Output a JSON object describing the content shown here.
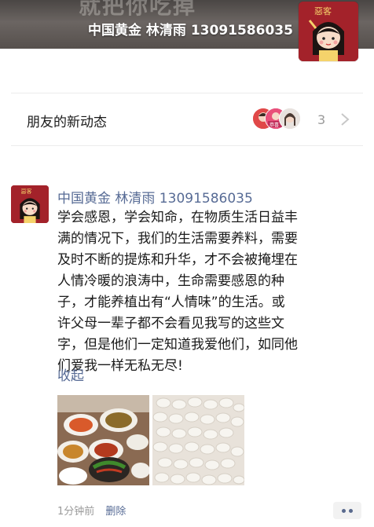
{
  "cover": {
    "banner_text": "就把你吃掉",
    "name_line": "中国黄金 林清雨 13091586035"
  },
  "profile_avatar": {
    "stamp_text": "惡客"
  },
  "friends_updates": {
    "label": "朋友的新动态",
    "count": "3",
    "badge_text": "恭喜"
  },
  "post": {
    "avatar_stamp": "惡客",
    "author": "中国黄金 林清雨 13091586035",
    "text_lines": [
      "学会感恩，学会知命，在物质生活日益丰",
      "满的情况下，我们的生活需要养料，需要",
      "及时不断的提炼和升华，才不会被掩埋在",
      "人情冷暖的浪涛中，生命需要感恩的种",
      "子，才能养植出有“人情味”的生活。或",
      "许父母一辈子都不会看见我写的这些文",
      "字，但是他们一定知道我爱他们，如同他",
      "们爱我一样无私无尽!"
    ],
    "collapse_label": "收起",
    "photos": [
      "dinner-dishes-photo",
      "dumplings-photo"
    ],
    "time": "1分钟前",
    "delete_label": "删除"
  },
  "colors": {
    "link": "#576b95",
    "meta": "#9a9a9a",
    "avatar_red": "#9b1c22"
  },
  "icons": [
    "chevron-right-icon",
    "more-dots-icon"
  ]
}
